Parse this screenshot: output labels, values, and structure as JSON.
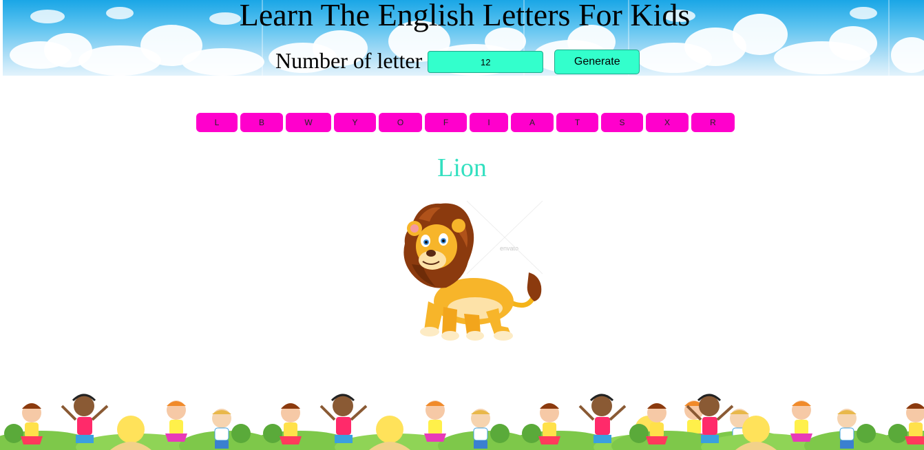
{
  "header": {
    "title": "Learn The English Letters For Kids",
    "number_label": "Number of letter",
    "number_value": "12",
    "generate_label": "Generate"
  },
  "letters": [
    "L",
    "B",
    "W",
    "Y",
    "O",
    "F",
    "I",
    "A",
    "T",
    "S",
    "X",
    "R"
  ],
  "word": {
    "text": "Lion",
    "watermark": "envato"
  },
  "colors": {
    "accent": "#33ffcc",
    "letter_button": "#ff00cc",
    "word_text": "#33e0c0",
    "sky": "#5cc3f0"
  },
  "images": {
    "header_background": "sky-clouds-illustration",
    "main_picture": "cartoon-lion-illustration",
    "footer_background": "kids-playing-illustration"
  }
}
